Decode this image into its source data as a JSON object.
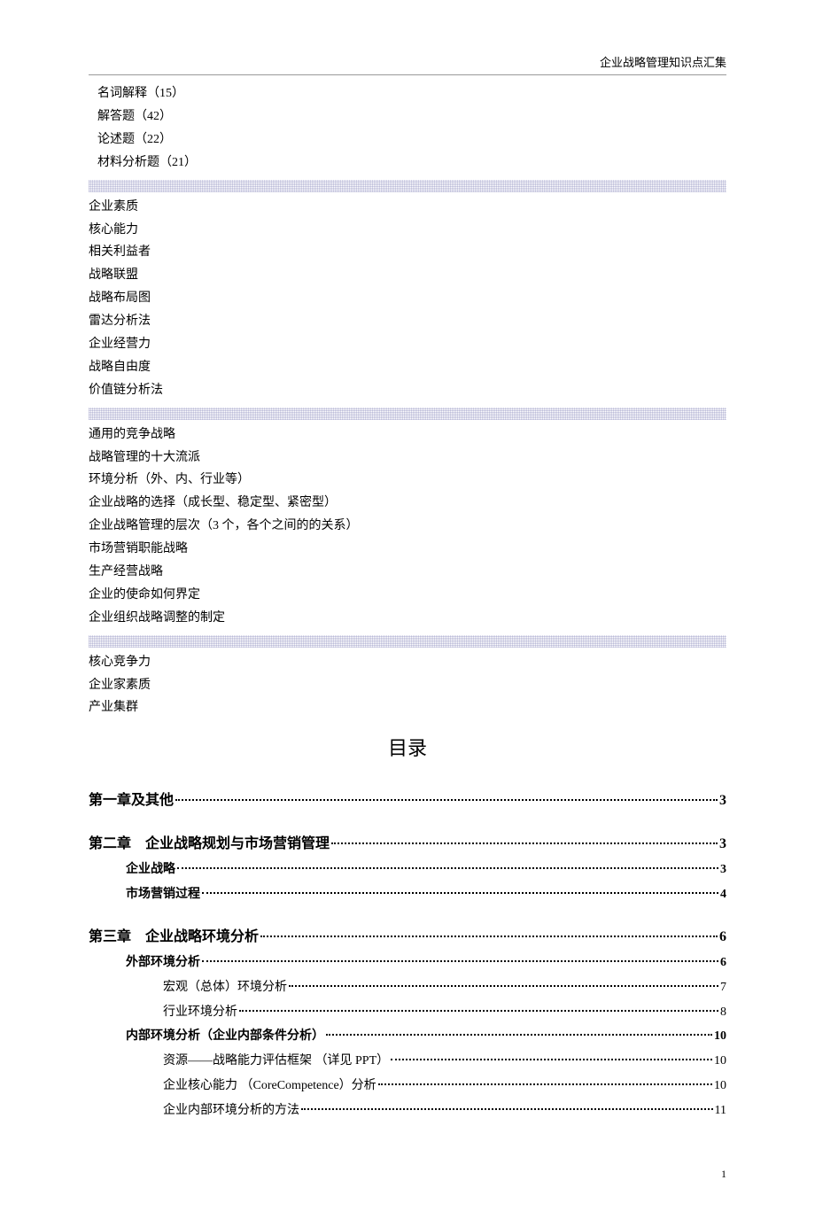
{
  "header": {
    "title": "企业战略管理知识点汇集"
  },
  "question_types": [
    "名词解释（15）",
    "解答题（42）",
    "论述题（22）",
    "材料分析题（21）"
  ],
  "terms": [
    "企业素质",
    "核心能力",
    "相关利益者",
    "战略联盟",
    "战略布局图",
    "雷达分析法",
    "企业经营力",
    "战略自由度",
    "价值链分析法"
  ],
  "topics": [
    "通用的竞争战略",
    "战略管理的十大流派",
    "环境分析（外、内、行业等）",
    "企业战略的选择（成长型、稳定型、紧密型）",
    "企业战略管理的层次（3 个，各个之间的的关系）",
    "市场营销职能战略",
    "生产经营战略",
    "企业的使命如何界定",
    "企业组织战略调整的制定"
  ],
  "essays": [
    "核心竞争力",
    "企业家素质",
    "产业集群"
  ],
  "toc_title": "目录",
  "toc": [
    {
      "level": 1,
      "label": "第一章及其他",
      "page": "3"
    },
    {
      "level": 1,
      "label": "第二章　企业战略规划与市场营销管理",
      "page": "3"
    },
    {
      "level": 2,
      "label": "企业战略",
      "page": "3"
    },
    {
      "level": 2,
      "label": "市场营销过程",
      "page": "4"
    },
    {
      "level": 1,
      "label": "第三章　企业战略环境分析",
      "page": "6"
    },
    {
      "level": 2,
      "label": "外部环境分析",
      "page": "6"
    },
    {
      "level": 3,
      "label": "宏观（总体）环境分析",
      "page": "7"
    },
    {
      "level": 3,
      "label": "行业环境分析",
      "page": "8"
    },
    {
      "level": 2,
      "label": "内部环境分析（企业内部条件分析）",
      "page": "10"
    },
    {
      "level": 3,
      "label": "资源——战略能力评估框架 （详见 PPT）",
      "page": "10"
    },
    {
      "level": 3,
      "label": "企业核心能力 （CoreCompetence）分析",
      "page": "10"
    },
    {
      "level": 3,
      "label": "企业内部环境分析的方法",
      "page": "11"
    }
  ],
  "page_number": "1"
}
